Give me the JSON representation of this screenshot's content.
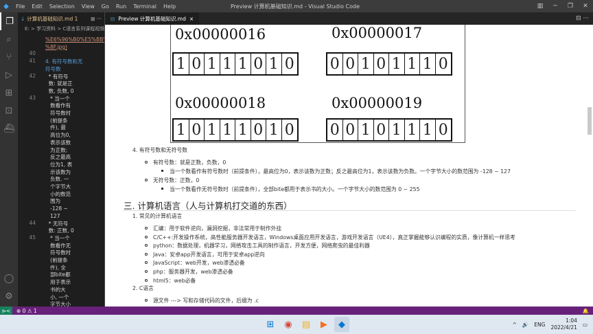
{
  "titlebar": {
    "logo": "vscode-logo",
    "menu": [
      "File",
      "Edit",
      "Selection",
      "View",
      "Go",
      "Run",
      "Terminal",
      "Help"
    ],
    "title": "Preview 计算机基础知识.md - Visual Studio Code",
    "controls": [
      "layout-icon",
      "─",
      "❐",
      "✕"
    ]
  },
  "activity": [
    "files-icon",
    "search-icon",
    "source-control-icon",
    "run-debug-icon",
    "extensions-icon",
    "remote-explorer-icon",
    "docker-icon"
  ],
  "activity_bottom": [
    "account-icon",
    "gear-icon"
  ],
  "editor_left": {
    "tab_label": "计算机基础知识.md 1",
    "tab_actions": "⊞ ···",
    "breadcrumb": "E: > 学习资料 > C语言系列课程视频",
    "lines": [
      {
        "n": "",
        "t": "%E6%96%B0%E5%BB%BA%",
        "cls": "u"
      },
      {
        "n": "",
        "t": "%8F.jpg)",
        "cls": "u"
      },
      {
        "n": "40",
        "t": "",
        "cls": ""
      },
      {
        "n": "41",
        "t": "4. 有符号数和无",
        "cls": "b"
      },
      {
        "n": "",
        "t": "符号数",
        "cls": "b"
      },
      {
        "n": "42",
        "t": "  * 有符号",
        "cls": ""
      },
      {
        "n": "",
        "t": "  数: 就是正",
        "cls": ""
      },
      {
        "n": "",
        "t": "  数, 负数, 0",
        "cls": ""
      },
      {
        "n": "43",
        "t": "   * 当一个",
        "cls": ""
      },
      {
        "n": "",
        "t": "   数看作有",
        "cls": ""
      },
      {
        "n": "",
        "t": "   符号数时",
        "cls": ""
      },
      {
        "n": "",
        "t": "   (前提条",
        "cls": ""
      },
      {
        "n": "",
        "t": "   件), 最",
        "cls": ""
      },
      {
        "n": "",
        "t": "   高位为0,",
        "cls": ""
      },
      {
        "n": "",
        "t": "   表示该数",
        "cls": ""
      },
      {
        "n": "",
        "t": "   为正数;",
        "cls": ""
      },
      {
        "n": "",
        "t": "   反之最高",
        "cls": ""
      },
      {
        "n": "",
        "t": "   位为1, 表",
        "cls": ""
      },
      {
        "n": "",
        "t": "   示该数为",
        "cls": ""
      },
      {
        "n": "",
        "t": "   负数. 一",
        "cls": ""
      },
      {
        "n": "",
        "t": "   个字节大",
        "cls": ""
      },
      {
        "n": "",
        "t": "   小的数范",
        "cls": ""
      },
      {
        "n": "",
        "t": "   围为",
        "cls": ""
      },
      {
        "n": "",
        "t": "   -128 ~",
        "cls": ""
      },
      {
        "n": "",
        "t": "   127",
        "cls": ""
      },
      {
        "n": "44",
        "t": "  * 无符号",
        "cls": ""
      },
      {
        "n": "",
        "t": "  数: 正数, 0",
        "cls": ""
      },
      {
        "n": "45",
        "t": "   * 当一个",
        "cls": ""
      },
      {
        "n": "",
        "t": "   数看作无",
        "cls": ""
      },
      {
        "n": "",
        "t": "   符号数时",
        "cls": ""
      },
      {
        "n": "",
        "t": "   (前提条",
        "cls": ""
      },
      {
        "n": "",
        "t": "   件), 全",
        "cls": ""
      },
      {
        "n": "",
        "t": "   部bite都",
        "cls": ""
      },
      {
        "n": "",
        "t": "   用于表示",
        "cls": ""
      },
      {
        "n": "",
        "t": "   书的大",
        "cls": ""
      },
      {
        "n": "",
        "t": "   小, 一个",
        "cls": ""
      },
      {
        "n": "",
        "t": "   字节大小",
        "cls": ""
      }
    ]
  },
  "preview": {
    "tab_label": "Preview 计算机基础知识.md",
    "tab_actions": "⊟ ···",
    "blocks": [
      {
        "hex": "0x00000016",
        "bits": [
          "1",
          "0",
          "1",
          "1",
          "1",
          "0",
          "1",
          "0"
        ]
      },
      {
        "hex": "0x00000017",
        "bits": [
          "0",
          "0",
          "1",
          "0",
          "1",
          "1",
          "1",
          "0"
        ]
      },
      {
        "hex": "0x00000018",
        "bits": [
          "1",
          "0",
          "1",
          "1",
          "1",
          "0",
          "1",
          "0"
        ]
      },
      {
        "hex": "0x00000019",
        "bits": [
          "0",
          "0",
          "1",
          "0",
          "1",
          "1",
          "1",
          "0"
        ]
      }
    ],
    "item4": "4. 有符号数和无符号数",
    "signed": "有符号数：就是正数，负数，0",
    "signed_desc": "当一个数看作有符号数时（前提条件），最高位为0，表示该数为正数；反之最高位为1，表示该数为负数。一个字节大小的数范围为 -128 ~ 127",
    "unsigned": "无符号数：正数，0",
    "unsigned_desc": "当一个数看作无符号数时（前提条件），全部bite都用于表示书的大小。一个字节大小的数范围为 0 ~ 255",
    "h3": "三. 计算机语言（人与计算机打交道的东西）",
    "item1": "1. 常见的计算机语言",
    "langs": [
      "汇编：用于软件逆向，漏洞挖掘，非法常用于制作外挂",
      "C/C++:开发操作系统，高性能服务器开发语言，Windows桌面应用开发语言，游戏开发语言（UE4），真正掌握能够认识编程的实质，像计算机一样思考",
      "python：数据处理，机器学习，网络攻击工具的制作语言，开发方便，网络爬虫的最佳利器",
      "Java：安卓app开发语言，可用于安卓app逆向",
      "JavaScript：web开发，web渗透必备",
      "php：服务器开发，web渗透必备",
      "html5：web必备"
    ],
    "item2": "2. C语言",
    "c_item": "源文件 ---> 写和存储代码的文件，后缀为 .c"
  },
  "status": {
    "remote": "⊳<",
    "errors": "⊗ 0 ⚠ 1",
    "bell": "🔔"
  },
  "taskbar": {
    "apps": [
      "windows-start-icon",
      "chrome-icon",
      "file-explorer-icon",
      "media-player-icon",
      "vscode-taskbar-icon"
    ],
    "tray": {
      "chevron": "^",
      "speaker": "🔊",
      "lang": "ENG",
      "time": "1:04",
      "date": "2022/4/21"
    }
  }
}
